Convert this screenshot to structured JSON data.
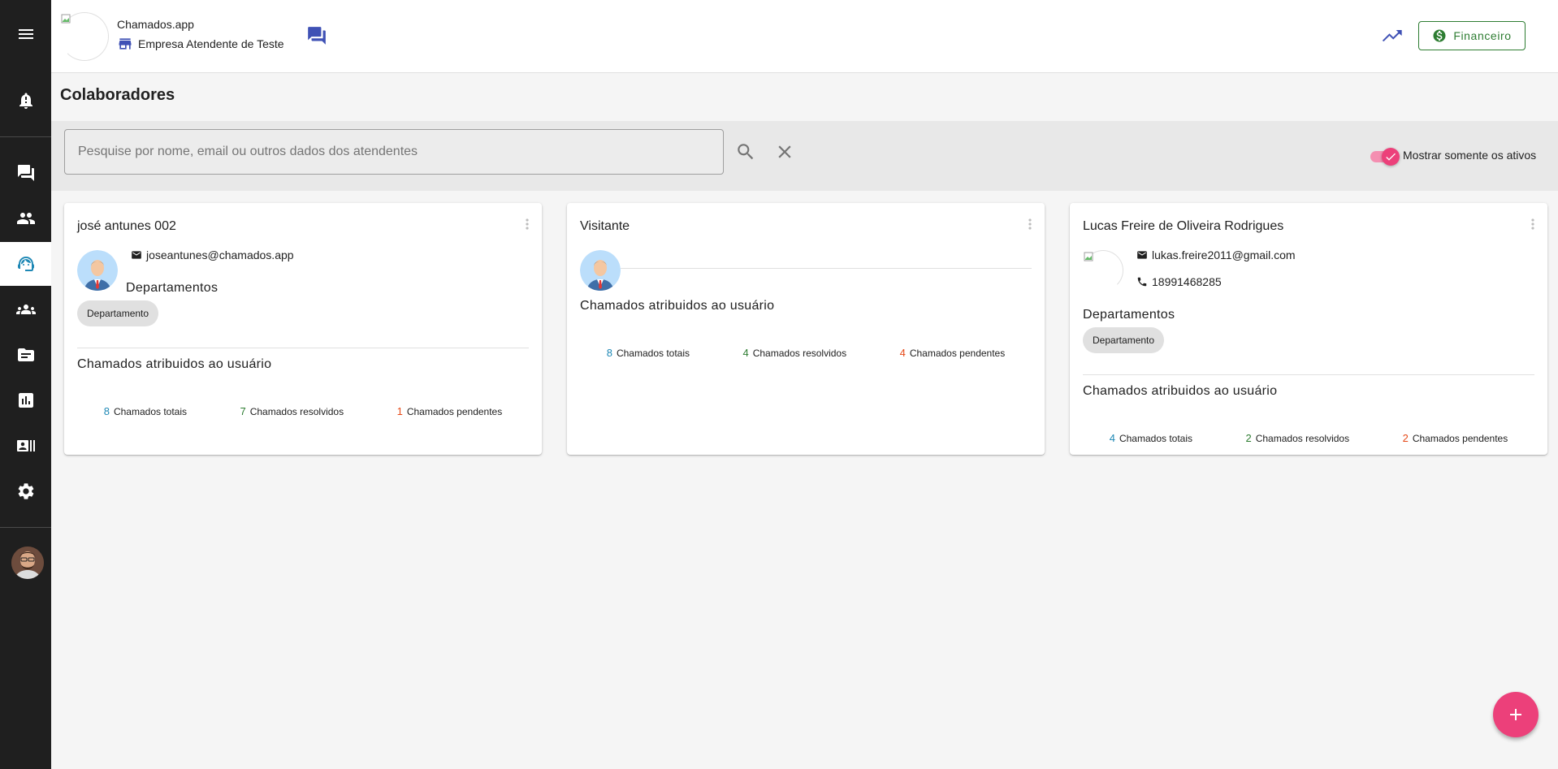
{
  "header": {
    "app_name": "Chamados.app",
    "company": "Empresa Atendente de Teste",
    "financeiro_label": "Financeiro"
  },
  "page": {
    "title": "Colaboradores"
  },
  "search": {
    "placeholder": "Pesquise por nome, email ou outros dados dos atendentes",
    "value": "",
    "toggle_label": "Mostrar somente os ativos",
    "toggle_on": true
  },
  "cards": [
    {
      "name": "josé antunes 002",
      "email": "joseantunes@chamados.app",
      "dept_title": "Departamentos",
      "dept_chip": "Departamento",
      "assign_title": "Chamados atribuidos ao usuário",
      "stats": {
        "total": "8",
        "total_label": "Chamados totais",
        "resolved": "7",
        "resolved_label": "Chamados resolvidos",
        "pending": "1",
        "pending_label": "Chamados pendentes"
      }
    },
    {
      "name": "Visitante",
      "assign_title": "Chamados atribuidos ao usuário",
      "stats": {
        "total": "8",
        "total_label": "Chamados totais",
        "resolved": "4",
        "resolved_label": "Chamados resolvidos",
        "pending": "4",
        "pending_label": "Chamados pendentes"
      }
    },
    {
      "name": "Lucas Freire de Oliveira Rodrigues",
      "email": "lukas.freire2011@gmail.com",
      "phone": "18991468285",
      "dept_title": "Departamentos",
      "dept_chip": "Departamento",
      "assign_title": "Chamados atribuidos ao usuário",
      "stats": {
        "total": "4",
        "total_label": "Chamados totais",
        "resolved": "2",
        "resolved_label": "Chamados resolvidos",
        "pending": "2",
        "pending_label": "Chamados pendentes"
      }
    }
  ],
  "colors": {
    "sidebar_bg": "#1f1f1f",
    "primary": "#3f51b5",
    "accent_pink": "#ec407a",
    "total_blue": "#1e88b5",
    "resolved_green": "#2e7d32",
    "pending_red": "#e64a19"
  },
  "icons": {
    "sidebar": [
      "menu-icon",
      "notifications-icon",
      "chat-icon",
      "people-icon",
      "support-agent-icon",
      "groups-icon",
      "folder-icon",
      "chart-icon",
      "contact-card-icon",
      "settings-icon"
    ],
    "header": [
      "store-icon",
      "forum-icon",
      "trending-icon",
      "dollar-icon"
    ]
  }
}
